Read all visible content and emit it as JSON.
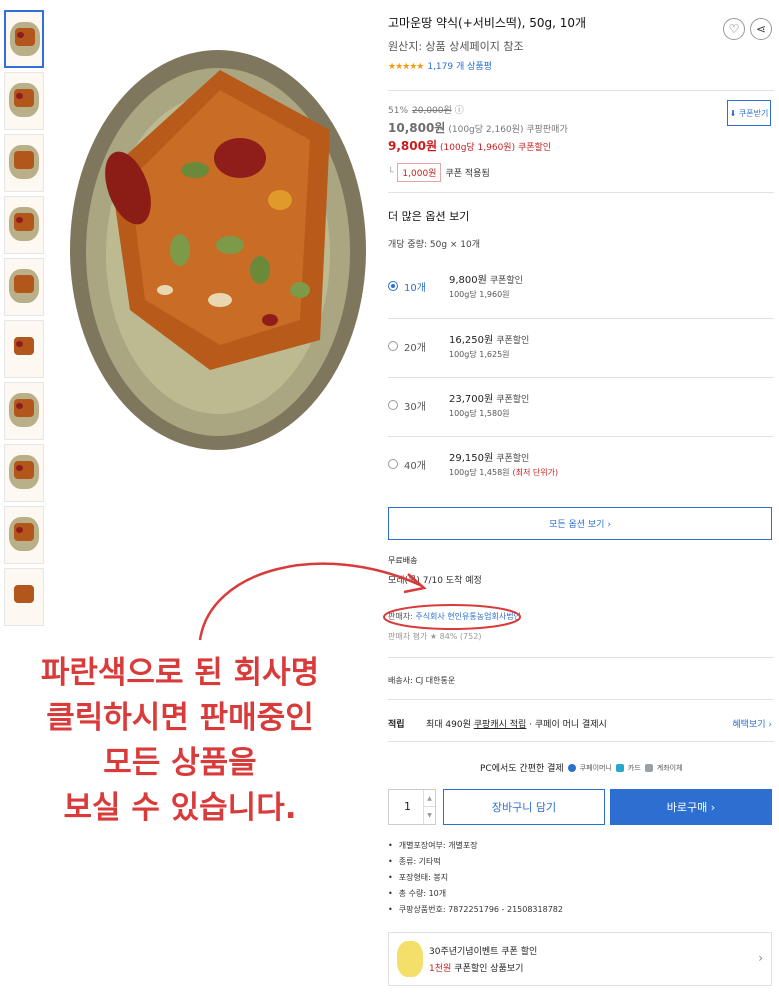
{
  "product": {
    "title": "고마운땅 약식(+서비스떡), 50g, 10개",
    "origin": "원산지: 상품 상세페이지 참조",
    "stars": "★★★★★",
    "review_count": "1,179 개 상품평",
    "rating_fraction": 0.9
  },
  "icons": {
    "wishlist": "heart-icon",
    "share": "share-icon"
  },
  "price": {
    "discount_pct": "51%",
    "original": "20,000원",
    "info_icon": "ⓘ",
    "sale": "10,800원",
    "sale_unit": "(100g당 2,160원) 쿠팡판매가",
    "coupon_price": "9,800원",
    "coupon_unit": "(100g당 1,960원) 쿠폰할인",
    "coupon_button": "쿠폰받기",
    "coupon_amount": "1,000원",
    "coupon_applied": "쿠폰 적용됨"
  },
  "options": {
    "heading": "더 많은 옵션 보기",
    "pack_weight": "개당 중량: 50g × 10개",
    "items": [
      {
        "qty": "10개",
        "price": "9,800원",
        "tag": "쿠폰할인",
        "per": "100g당 1,960원",
        "low": ""
      },
      {
        "qty": "20개",
        "price": "16,250원",
        "tag": "쿠폰할인",
        "per": "100g당 1,625원",
        "low": ""
      },
      {
        "qty": "30개",
        "price": "23,700원",
        "tag": "쿠폰할인",
        "per": "100g당 1,580원",
        "low": ""
      },
      {
        "qty": "40개",
        "price": "29,150원",
        "tag": "쿠폰할인",
        "per": "100g당 1,458원",
        "low": "(최저 단위가)"
      }
    ],
    "all_button": "모든 옵션 보기 ›"
  },
  "shipping": {
    "label": "무료배송",
    "eta": "모레(목) 7/10 도착 예정",
    "seller_label": "판매자: ",
    "seller_name": "주식회사 현인유통농업회사법인",
    "seller_rate": "판매자 평가 ★ 84% (752)",
    "shipper": "배송사: CJ 대한통운"
  },
  "reward": {
    "label": "적립",
    "desc_prefix": "최대 490원 ",
    "desc_link": "쿠팡캐시 적립",
    "desc_suffix": " · 쿠페이 머니 결제시",
    "benefit": "혜택보기 ›"
  },
  "easy_pay": {
    "label": "PC에서도 간편한 결제",
    "methods": [
      "쿠페이머니",
      "카드",
      "계좌이체"
    ],
    "colors": [
      "#2c6fd1",
      "#2aa7c9",
      "#9aa0a6"
    ]
  },
  "purchase": {
    "quantity": "1",
    "cart": "장바구니 담기",
    "buy": "바로구매 ›"
  },
  "specs": [
    "개별포장여부: 개별포장",
    "종류: 기타떡",
    "포장형태: 봉지",
    "총 수량: 10개",
    "쿠팡상품번호: 7872251796 - 21508318782"
  ],
  "promo": {
    "line1": "30주년기념이벤트 쿠폰 할인",
    "line2_red": "1천원",
    "line2": "쿠폰할인 상품보기",
    "chevron": "›"
  },
  "overlay": {
    "lines": [
      "파란색으로 된 회사명",
      "클릭하시면 판매중인",
      "모든 상품을",
      "보실 수 있습니다."
    ],
    "color": "#d93b3b"
  }
}
